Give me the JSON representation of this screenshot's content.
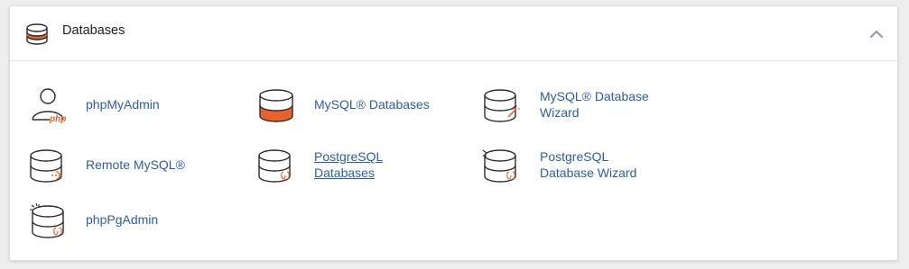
{
  "panel": {
    "title": "Databases",
    "collapse_icon": "chevron-up-icon"
  },
  "items": [
    {
      "label": "phpMyAdmin",
      "icon": "phpmyadmin-icon"
    },
    {
      "label": "MySQL® Databases",
      "icon": "mysql-databases-icon"
    },
    {
      "label": "MySQL® Database\nWizard",
      "icon": "mysql-wizard-icon"
    },
    {
      "label": "Remote MySQL®",
      "icon": "remote-mysql-icon"
    },
    {
      "label": "PostgreSQL\nDatabases",
      "icon": "postgresql-databases-icon"
    },
    {
      "label": "PostgreSQL\nDatabase Wizard",
      "icon": "postgresql-wizard-icon"
    },
    {
      "label": "phpPgAdmin",
      "icon": "phppgadmin-icon"
    }
  ],
  "colors": {
    "link": "#2a5ea8",
    "accent_orange": "#e8622c",
    "icon_stroke": "#2b2b2b"
  }
}
